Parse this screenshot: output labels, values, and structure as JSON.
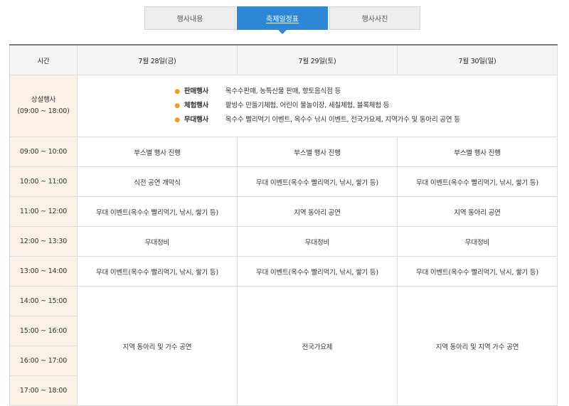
{
  "tabs": [
    {
      "label": "행사내용",
      "active": false
    },
    {
      "label": "축제일정표",
      "active": true
    },
    {
      "label": "행사사진",
      "active": false
    }
  ],
  "colors": {
    "accent": "#2e86d6",
    "time_bg": "#fbf2e7",
    "bullet": "#f0a020"
  },
  "schedule": {
    "headers": {
      "time": "시간",
      "day1": "7월 28일(금)",
      "day2": "7월 29일(토)",
      "day3": "7월 30일(일)"
    },
    "permanent": {
      "title": "상설행사",
      "hours": "(09:00 ~ 18:00)",
      "items": [
        {
          "category": "판매행사",
          "details": "옥수수판매, 농특산물 판매, 향토음식점 등"
        },
        {
          "category": "체험행사",
          "details": "팥빙수 만들기체험, 어린이 물놀이장, 세칠체험, 블록체험 등"
        },
        {
          "category": "무대행사",
          "details": "옥수수 빨리먹기 이벤트, 옥수수 낚시 이벤트, 전국가요제, 지역가수 및 동아리 공연 등"
        }
      ]
    },
    "rows": [
      {
        "time": "09:00 ~ 10:00",
        "day1": "부스별 행사 진행",
        "day2": "부스별 행사 진행",
        "day3": "부스별 행사 진행"
      },
      {
        "time": "10:00 ~ 11:00",
        "day1": "식전 공연 개막식",
        "day2": "무대 이벤트(옥수수 빨리먹기, 낚시, 쌓기 등)",
        "day3": "무대 이벤트(옥수수 빨리먹기, 낚시, 쌓기 등)"
      },
      {
        "time": "11:00 ~ 12:00",
        "day1": "무대 이벤트(옥수수 빨리먹기, 낚시, 쌓기 등)",
        "day2": "지역 동아리 공연",
        "day3": "지역 동아리 공연"
      },
      {
        "time": "12:00 ~ 13:30",
        "day1": "무대정비",
        "day2": "무대정비",
        "day3": "무대정비"
      },
      {
        "time": "13:00 ~ 14:00",
        "day1": "무대 이벤트(옥수수 빨리먹기, 낚시, 쌓기 등)",
        "day2": "무대 이벤트(옥수수 빨리먹기, 낚시, 쌓기 등)",
        "day3": "무대 이벤트(옥수수 빨리먹기, 낚시, 쌓기 등)"
      }
    ],
    "afternoon": {
      "times": [
        "14:00 ~ 15:00",
        "15:00 ~ 16:00",
        "16:00 ~ 17:00",
        "17:00 ~ 18:00"
      ],
      "day1": "지역 동아리 및 가수 공연",
      "day2": "전국가요제",
      "day3": "지역 동아리 및 지역 가수 공연"
    }
  }
}
